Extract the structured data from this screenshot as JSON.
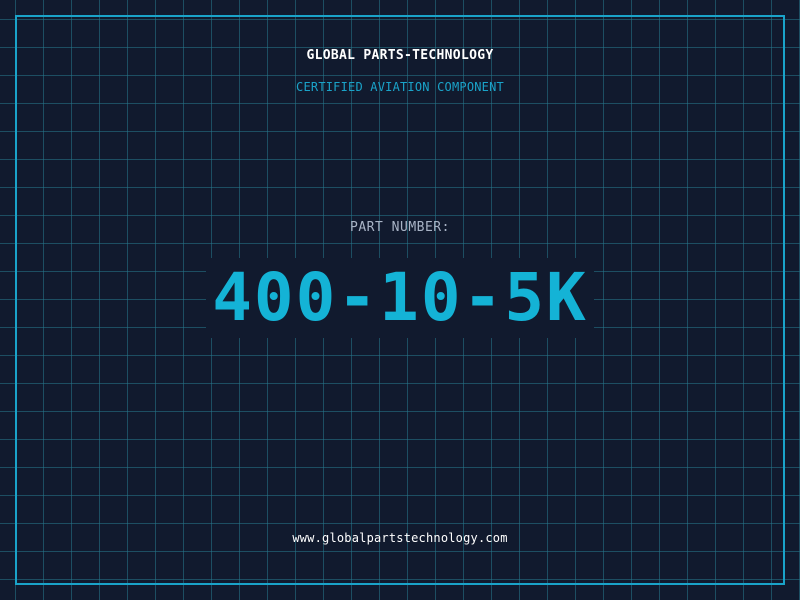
{
  "header": {
    "company_name": "GLOBAL PARTS-TECHNOLOGY",
    "tagline": "CERTIFIED AVIATION COMPONENT"
  },
  "part": {
    "label": "PART NUMBER:",
    "number": "400-10-5K"
  },
  "footer": {
    "website": "www.globalpartstechnology.com"
  },
  "colors": {
    "background": "#111a2e",
    "accent": "#14b3d6",
    "grid": "#26788c",
    "text": "#ffffff",
    "label": "#a9b4c6"
  }
}
